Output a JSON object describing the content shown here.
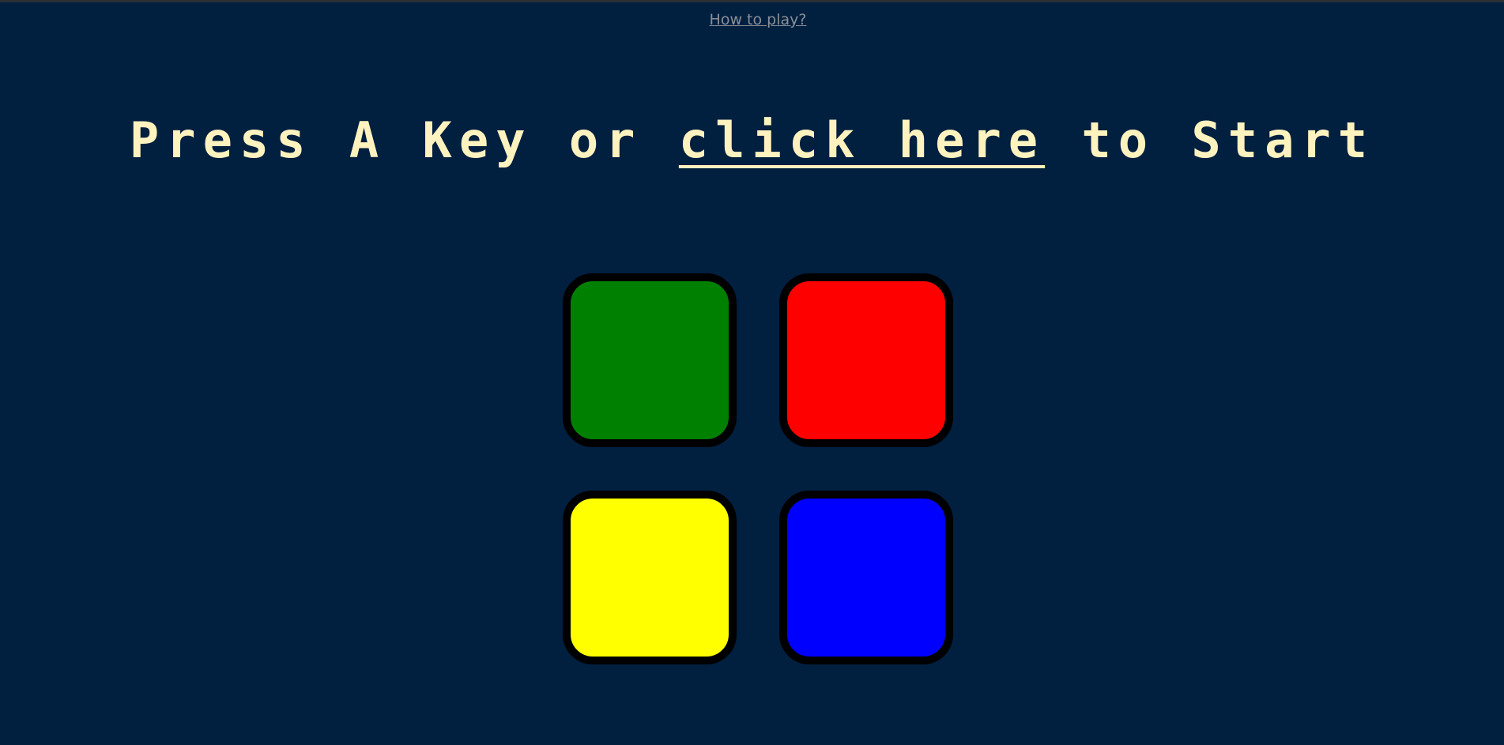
{
  "help_link": "How to play?",
  "title": {
    "prefix": "Press A Key or ",
    "link": "click here",
    "suffix": " to Start"
  },
  "colors": {
    "background": "#011F3F",
    "title_text": "#FEF2BF",
    "help_link": "#8a8f98",
    "button_border": "#000000"
  },
  "buttons": [
    {
      "id": "green",
      "color": "#008000"
    },
    {
      "id": "red",
      "color": "#FF0000"
    },
    {
      "id": "yellow",
      "color": "#FFFF00"
    },
    {
      "id": "blue",
      "color": "#0000FF"
    }
  ]
}
